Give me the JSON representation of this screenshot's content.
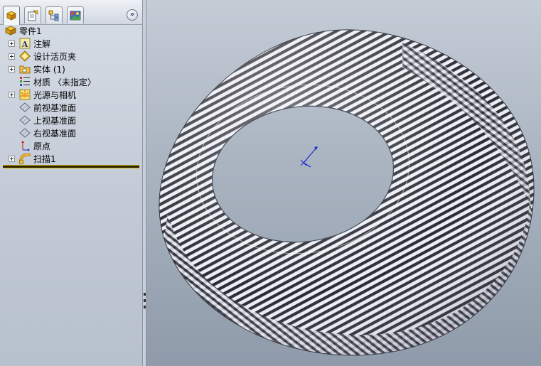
{
  "feature_tree": {
    "tabs": [
      {
        "icon": "feature-manager-icon"
      },
      {
        "icon": "property-manager-icon"
      },
      {
        "icon": "configuration-manager-icon"
      },
      {
        "icon": "display-manager-icon"
      }
    ],
    "expand_label": "»",
    "root": {
      "label": "零件1",
      "icon": "part-icon"
    },
    "items": [
      {
        "label": "注解",
        "icon": "annotations-icon",
        "expandable": true
      },
      {
        "label": "设计活页夹",
        "icon": "design-binder-icon",
        "expandable": true
      },
      {
        "label": "实体 (1)",
        "icon": "solid-bodies-icon",
        "expandable": true
      },
      {
        "label": "材质 〈未指定〉",
        "icon": "material-icon",
        "expandable": false
      },
      {
        "label": "光源与相机",
        "icon": "lights-cameras-icon",
        "expandable": true
      },
      {
        "label": "前视基准面",
        "icon": "plane-icon",
        "expandable": false
      },
      {
        "label": "上视基准面",
        "icon": "plane-icon",
        "expandable": false
      },
      {
        "label": "右视基准面",
        "icon": "plane-icon",
        "expandable": false
      },
      {
        "label": "原点",
        "icon": "origin-icon",
        "expandable": false
      },
      {
        "label": "扫描1",
        "icon": "sweep-feature-icon",
        "expandable": true
      }
    ]
  },
  "colors": {
    "stripe_dark": "#2b2b33",
    "stripe_light": "#eceef6",
    "rollback_bar": "#d6b300",
    "axis_blue": "#1a2acc"
  }
}
